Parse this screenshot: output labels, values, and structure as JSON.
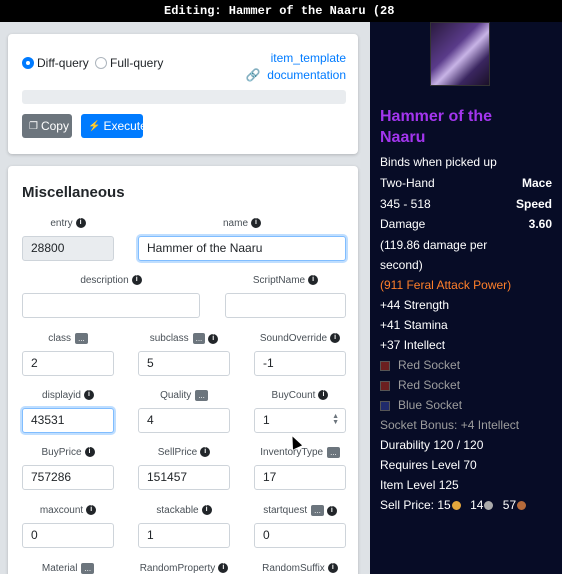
{
  "window": {
    "title": "Editing: Hammer of the Naaru (28"
  },
  "query": {
    "diff_label": "Diff-query",
    "full_label": "Full-query",
    "selected": "diff",
    "doc_link": "item_template documentation",
    "copy_label": "Copy",
    "execute_label": "Execute",
    "progress_fraction": 0
  },
  "misc": {
    "title": "Miscellaneous",
    "fields": {
      "entry": {
        "label": "entry",
        "value": "28800"
      },
      "name": {
        "label": "name",
        "value": "Hammer of the Naaru"
      },
      "description": {
        "label": "description",
        "value": ""
      },
      "scriptname": {
        "label": "ScriptName",
        "value": ""
      },
      "class": {
        "label": "class",
        "value": "2"
      },
      "subclass": {
        "label": "subclass",
        "value": "5"
      },
      "soundoverride": {
        "label": "SoundOverride",
        "value": "-1"
      },
      "displayid": {
        "label": "displayid",
        "value": "43531"
      },
      "quality": {
        "label": "Quality",
        "value": "4"
      },
      "buycount": {
        "label": "BuyCount",
        "value": "1"
      },
      "buyprice": {
        "label": "BuyPrice",
        "value": "757286"
      },
      "sellprice": {
        "label": "SellPrice",
        "value": "151457"
      },
      "inventorytype": {
        "label": "InventoryType",
        "value": "17"
      },
      "maxcount": {
        "label": "maxcount",
        "value": "0"
      },
      "stackable": {
        "label": "stackable",
        "value": "1"
      },
      "startquest": {
        "label": "startquest",
        "value": "0"
      },
      "material": {
        "label": "Material"
      },
      "randomproperty": {
        "label": "RandomProperty"
      },
      "randomsuffix": {
        "label": "RandomSuffix"
      }
    },
    "more_button": "...",
    "info_glyph": "i"
  },
  "tooltip": {
    "icon": "hammer-item-icon",
    "name": "Hammer of the Naaru",
    "bind": "Binds when picked up",
    "slot": "Two-Hand",
    "type": "Mace",
    "damage_range": "345 - 518",
    "damage_label": "Damage",
    "speed_label": "Speed",
    "speed": "3.60",
    "dps_line1": "(119.86 damage per",
    "dps_line2": "second)",
    "feral": "(911 Feral Attack Power)",
    "stats": [
      "+44 Strength",
      "+41 Stamina",
      "+37 Intellect"
    ],
    "sockets": [
      "Red Socket",
      "Red Socket",
      "Blue Socket"
    ],
    "socket_bonus": "Socket Bonus: +4 Intellect",
    "durability": "Durability 120 / 120",
    "requires": "Requires Level 70",
    "item_level": "Item Level 125",
    "sell_label": "Sell Price:",
    "sell_gold": "15",
    "sell_silver": "14",
    "sell_copper": "57",
    "colors": {
      "epic": "#a335ee",
      "feral": "#ff7f2a",
      "muted": "#9d9d9d"
    }
  }
}
